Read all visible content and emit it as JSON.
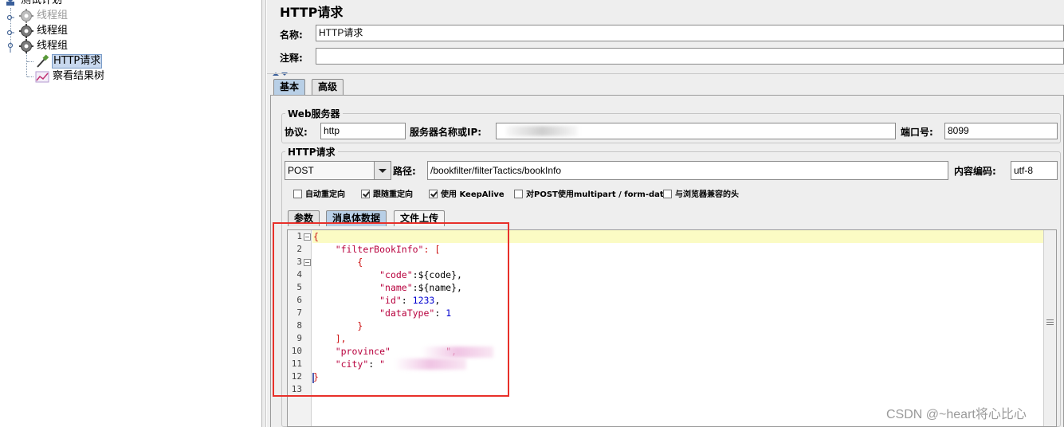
{
  "tree": {
    "items": [
      {
        "label": "测试计划"
      },
      {
        "label": "线程组"
      },
      {
        "label": "线程组"
      },
      {
        "label": "线程组"
      },
      {
        "label": "HTTP请求"
      },
      {
        "label": "察看结果树"
      }
    ]
  },
  "panel": {
    "title": "HTTP请求",
    "name_label": "名称:",
    "name_value": "HTTP请求",
    "comment_label": "注释:",
    "comment_value": "",
    "tabs": [
      {
        "label": "基本"
      },
      {
        "label": "高级"
      }
    ],
    "web_server": {
      "title": "Web服务器",
      "protocol_label": "协议:",
      "protocol_value": "http",
      "server_label": "服务器名称或IP:",
      "server_value": "",
      "port_label": "端口号:",
      "port_value": "8099"
    },
    "http_request": {
      "title": "HTTP请求",
      "method_value": "POST",
      "path_label": "路径:",
      "path_value": "/bookfilter/filterTactics/bookInfo",
      "encoding_label": "内容编码:",
      "encoding_value": "utf-8"
    },
    "checkboxes": [
      {
        "label": "自动重定向",
        "checked": false
      },
      {
        "label": "跟随重定向",
        "checked": true
      },
      {
        "label": "使用 KeepAlive",
        "checked": true
      },
      {
        "label": "对POST使用multipart / form-data",
        "checked": false
      },
      {
        "label": "与浏览器兼容的头",
        "checked": false
      }
    ],
    "body_tabs": [
      {
        "label": "参数"
      },
      {
        "label": "消息体数据"
      },
      {
        "label": "文件上传"
      }
    ],
    "code": {
      "line_numbers": [
        "1",
        "2",
        "3",
        "4",
        "5",
        "6",
        "7",
        "8",
        "9",
        "10",
        "11",
        "12",
        "13"
      ],
      "lines": [
        {
          "segments": [
            {
              "t": "{",
              "c": "punc"
            }
          ]
        },
        {
          "segments": [
            {
              "t": "    ",
              "c": "plain"
            },
            {
              "t": "\"filterBookInfo\"",
              "c": "key"
            },
            {
              "t": ": [",
              "c": "punc"
            }
          ]
        },
        {
          "segments": [
            {
              "t": "        {",
              "c": "punc"
            }
          ]
        },
        {
          "segments": [
            {
              "t": "            ",
              "c": "plain"
            },
            {
              "t": "\"code\"",
              "c": "key"
            },
            {
              "t": ":${code},",
              "c": "plain"
            }
          ]
        },
        {
          "segments": [
            {
              "t": "            ",
              "c": "plain"
            },
            {
              "t": "\"name\"",
              "c": "key"
            },
            {
              "t": ":${name},",
              "c": "plain"
            }
          ]
        },
        {
          "segments": [
            {
              "t": "            ",
              "c": "plain"
            },
            {
              "t": "\"id\"",
              "c": "key"
            },
            {
              "t": ": ",
              "c": "plain"
            },
            {
              "t": "1233",
              "c": "num"
            },
            {
              "t": ",",
              "c": "plain"
            }
          ]
        },
        {
          "segments": [
            {
              "t": "            ",
              "c": "plain"
            },
            {
              "t": "\"dataType\"",
              "c": "key"
            },
            {
              "t": ": ",
              "c": "plain"
            },
            {
              "t": "1",
              "c": "num"
            }
          ]
        },
        {
          "segments": [
            {
              "t": "        }",
              "c": "punc"
            }
          ]
        },
        {
          "segments": [
            {
              "t": "    ],",
              "c": "punc"
            }
          ]
        },
        {
          "segments": [
            {
              "t": "    ",
              "c": "plain"
            },
            {
              "t": "\"province\"",
              "c": "key"
            },
            {
              "t": "          ",
              "c": "plain"
            },
            {
              "t": "\",",
              "c": "key"
            }
          ]
        },
        {
          "segments": [
            {
              "t": "    ",
              "c": "plain"
            },
            {
              "t": "\"city\"",
              "c": "key"
            },
            {
              "t": ": ",
              "c": "plain"
            },
            {
              "t": "\"",
              "c": "key"
            }
          ]
        },
        {
          "segments": [
            {
              "t": "}",
              "c": "punc"
            }
          ]
        },
        {
          "segments": [
            {
              "t": "",
              "c": "plain"
            }
          ]
        }
      ]
    }
  },
  "watermark": "CSDN @~heart将心比心",
  "colors": {
    "highlight_border": "#e8302a",
    "current_line": "#fbfbc4",
    "json_key": "#b8003d",
    "json_number": "#0000d0"
  }
}
